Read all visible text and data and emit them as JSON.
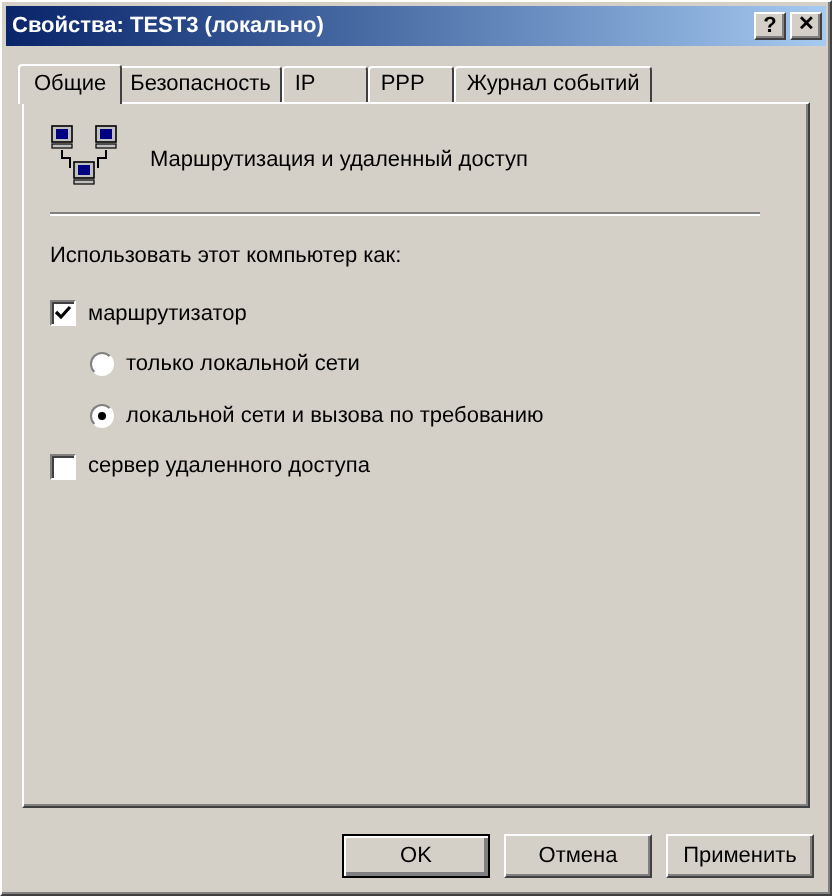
{
  "window": {
    "title": "Свойства: TEST3 (локально)",
    "help_button": "?",
    "close_button": "✕"
  },
  "tabs": [
    {
      "label": "Общие",
      "selected": true
    },
    {
      "label": "Безопасность",
      "selected": false
    },
    {
      "label": "IP",
      "selected": false
    },
    {
      "label": "PPP",
      "selected": false
    },
    {
      "label": "Журнал событий",
      "selected": false
    }
  ],
  "heading": "Маршрутизация и удаленный доступ",
  "group_label": "Использовать этот компьютер как:",
  "options": [
    {
      "kind": "checkbox",
      "label": "маршрутизатор",
      "checked": true,
      "children": [
        {
          "kind": "radio",
          "label": "только локальной сети",
          "selected": false
        },
        {
          "kind": "radio",
          "label": "локальной сети и вызова по требованию",
          "selected": true
        }
      ]
    },
    {
      "kind": "checkbox",
      "label": "сервер удаленного доступа",
      "checked": false
    }
  ],
  "buttons": [
    {
      "label": "OK",
      "default": true
    },
    {
      "label": "Отмена",
      "default": false
    },
    {
      "label": "Применить",
      "default": false
    }
  ]
}
